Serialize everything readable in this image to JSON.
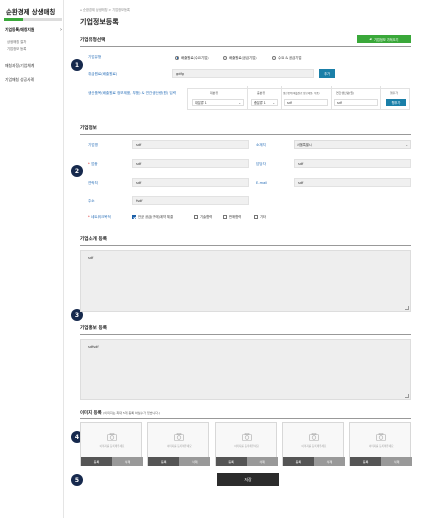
{
  "sidebar": {
    "title": "순환경제 상생매칭",
    "items": [
      {
        "label": "기업등록/매칭지원",
        "active": true
      },
      {
        "label": "매칭과정/기업체계",
        "active": false
      },
      {
        "label": "기업매칭 성공사례",
        "active": false
      }
    ],
    "subitems": [
      "상생매칭 절차",
      "기업정보 등록"
    ]
  },
  "breadcrumb": "순환경제 상생매칭  >  기업정보등록",
  "page_title": "기업정보등록",
  "type_section": {
    "title": "기업유형선택",
    "green_button": "기업정보 가져오기",
    "type_label": "기업유형",
    "radios": [
      {
        "label": "배출원료(수요기업)",
        "selected": true
      },
      {
        "label": "배출원료(공급기업)",
        "selected": false
      },
      {
        "label": "수요 & 공급기업",
        "selected": false
      }
    ],
    "material_label": "취급원료(배출원료)",
    "material_value": "gdfg",
    "add_button": "추가",
    "info_label": "생산품목(배출원료 정보제품, 부품) & 연간생산량(원) 입력",
    "columns": [
      "대분류",
      "중분류",
      "생산품목(배출원료 정보제품, 부품)",
      "연간생산량(원)",
      "행추가"
    ],
    "major_value": "대분류 1",
    "minor_value": "중분류 1",
    "product_value": "sdf",
    "amount_value": "sdf",
    "delete_button": "행추가"
  },
  "company_section": {
    "title": "기업정보",
    "company_name_label": "기업명",
    "company_name_value": "sdf",
    "location_label": "소재지",
    "location_value": "서울특별시",
    "industry_label": "업종",
    "industry_value": "sdf",
    "manager_label": "담당자",
    "manager_value": "sdf",
    "contact_label": "연락처",
    "contact_value": "sdf",
    "email_label": "E-mail",
    "email_value": "sdf",
    "address_label": "주소",
    "address_value": "fsdf",
    "network_label": "네트워크목적",
    "network_options": [
      {
        "label": "안균 공급(구매)계약 체결",
        "checked": true
      },
      {
        "label": "기술협력",
        "checked": false
      },
      {
        "label": "판매협력",
        "checked": false
      },
      {
        "label": "기타",
        "checked": false
      }
    ]
  },
  "intro_section": {
    "title": "기업소개 등록",
    "value": "sdf"
  },
  "promo_section": {
    "title": "기업홍보 등록",
    "value": "sdfsdf"
  },
  "image_section": {
    "title": "이미지 등록",
    "note": "(이미지는 최대 5개 등록 하실수가 있습니다.)",
    "slot_text": "이미지를 등록해주세요",
    "register_label": "등록",
    "delete_label": "삭제",
    "slot_count": 5
  },
  "save_button": "저장",
  "badges": [
    "1",
    "2",
    "3",
    "4",
    "5"
  ],
  "colors": {
    "accent_green": "#3aa83a",
    "label_blue": "#2a6fb8",
    "button_blue": "#1a7fa8",
    "badge_navy": "#16294d",
    "save_dark": "#2c2c2c"
  }
}
